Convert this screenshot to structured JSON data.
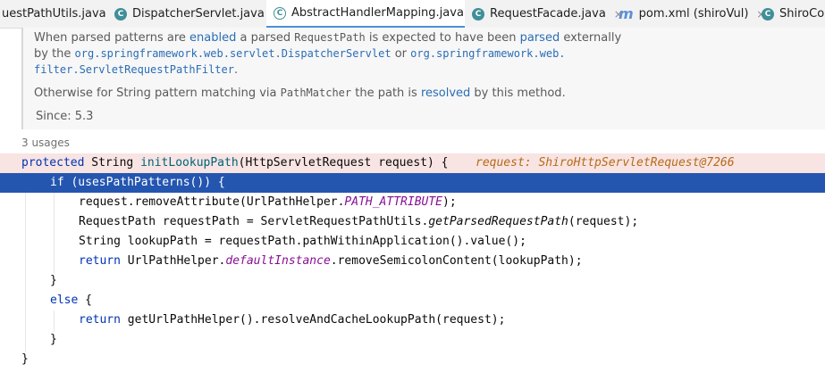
{
  "tabs": [
    {
      "label": "uestPathUtils.java",
      "icon": "java-class-icon",
      "active": false
    },
    {
      "label": "DispatcherServlet.java",
      "icon": "java-class-icon",
      "active": false
    },
    {
      "label": "AbstractHandlerMapping.java",
      "icon": "abstract-class-icon",
      "active": true
    },
    {
      "label": "RequestFacade.java",
      "icon": "java-class-icon",
      "active": false
    },
    {
      "label": "pom.xml (shiroVul)",
      "icon": "maven-icon",
      "active": false
    },
    {
      "label": "ShiroCon",
      "icon": "java-class-icon",
      "active": false
    }
  ],
  "tab_close_glyph": "×",
  "doc": {
    "p1_a": "When parsed patterns are ",
    "p1_b": "enabled",
    "p1_c": " a parsed ",
    "p1_d": "RequestPath",
    "p1_e": " is expected to have been ",
    "p1_f": "parsed",
    "p1_g": " externally",
    "p2_a": "by the ",
    "p2_b": "org.springframework.web.servlet.DispatcherServlet",
    "p2_c": " or ",
    "p2_d": "org.springframework.web.",
    "p3_a": "filter.ServletRequestPathFilter",
    "p3_b": ".",
    "p4_a": "Otherwise for String pattern matching via ",
    "p4_b": "PathMatcher",
    "p4_c": " the path is ",
    "p4_d": "resolved",
    "p4_e": " by this method.",
    "since": "Since: 5.3"
  },
  "usages": "3 usages",
  "code": {
    "l1_kw": "protected",
    "l1_a": " String ",
    "l1_meth": "initLookupPath",
    "l1_b": "(HttpServletRequest request) {",
    "l1_inlay": "request: ShiroHttpServletRequest@7266",
    "l2_kw": "if",
    "l2_a": " (usesPathPatterns()) {",
    "l3_a": "request.removeAttribute(UrlPathHelper.",
    "l3_field": "PATH_ATTRIBUTE",
    "l3_b": ");",
    "l4_a": "RequestPath requestPath = ServletRequestPathUtils.",
    "l4_meth": "getParsedRequestPath",
    "l4_b": "(request);",
    "l5_a": "String lookupPath = requestPath.pathWithinApplication().value();",
    "l6_kw": "return",
    "l6_a": " UrlPathHelper.",
    "l6_field": "defaultInstance",
    "l6_b": ".removeSemicolonContent(lookupPath);",
    "l7_a": "}",
    "l8_kw": "else",
    "l8_a": " {",
    "l9_kw": "return",
    "l9_a": " getUrlPathHelper().resolveAndCacheLookupPath(request);",
    "l10_a": "}",
    "l11_a": "}"
  },
  "colors": {
    "keyword": "#0033b3",
    "method_decl": "#00627a",
    "static_field": "#871094",
    "inlay_hint": "#b86a15",
    "selection": "#2456b0",
    "signature_highlight": "#f7e4e3",
    "doc_link": "#2a6db5"
  }
}
